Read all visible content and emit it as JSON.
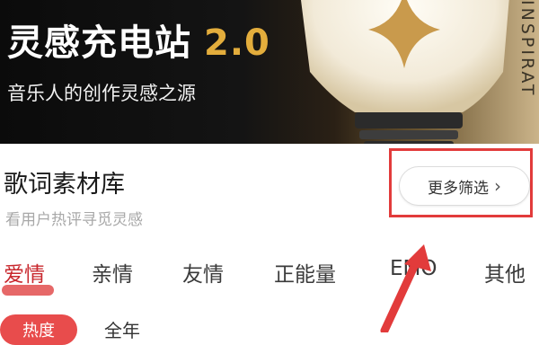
{
  "banner": {
    "title": "灵感充电站",
    "version": "2.0",
    "subtitle": "音乐人的创作灵感之源",
    "side_text": "INSPIRAT"
  },
  "section": {
    "title": "歌词素材库",
    "subtitle": "看用户热评寻觅灵感",
    "filter_label": "更多筛选"
  },
  "tabs": [
    {
      "label": "爱情",
      "active": true
    },
    {
      "label": "亲情",
      "active": false
    },
    {
      "label": "友情",
      "active": false
    },
    {
      "label": "正能量",
      "active": false
    },
    {
      "label": "EMO",
      "active": false
    },
    {
      "label": "其他",
      "active": false
    }
  ],
  "bottom": {
    "hot_label": "热度",
    "all_label": "全年"
  },
  "colors": {
    "accent_red": "#c8282e",
    "highlight_red": "#e23b3b",
    "banner_gold": "#e3ad3c"
  }
}
